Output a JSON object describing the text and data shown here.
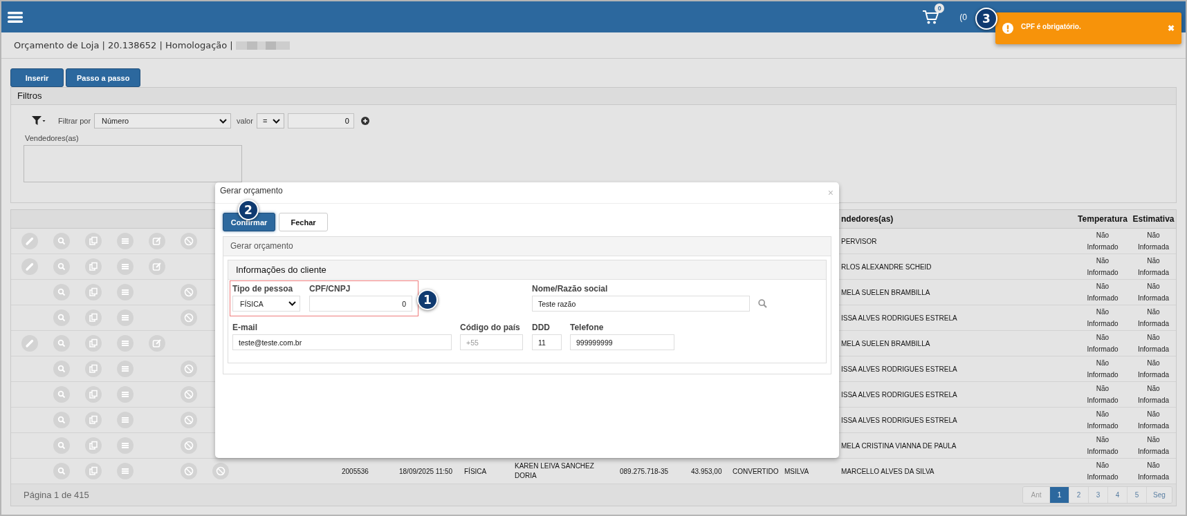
{
  "topbar": {
    "cart_count": "0",
    "user_text": "(0"
  },
  "toast": {
    "message": "CPF é obrigatório.",
    "close": "✖",
    "step": "3"
  },
  "page_title": "Orçamento de Loja | 20.138652 | Homologação |",
  "actions": [
    {
      "label": "Inserir"
    },
    {
      "label": "Passo a passo"
    }
  ],
  "filters": {
    "title": "Filtros",
    "filter_by_label": "Filtrar por",
    "filter_by": "Número",
    "value_label": "valor",
    "operator": "=",
    "value": "0",
    "sellers_label": "Vendedores(as)"
  },
  "table": {
    "columns": [
      "ndedores(as)",
      "Temperatura",
      "Estimativa"
    ],
    "rows": [
      {
        "actions": [
          {
            "kind": "pencil"
          },
          {
            "kind": "search"
          },
          {
            "kind": "copy"
          },
          {
            "kind": "list"
          },
          {
            "kind": "edit"
          },
          {
            "kind": "ban"
          }
        ],
        "seller": "PERVISOR",
        "temperature": "Não Informado",
        "estimate": "Não Informada"
      },
      {
        "actions": [
          {
            "kind": "pencil"
          },
          {
            "kind": "search"
          },
          {
            "kind": "copy"
          },
          {
            "kind": "list"
          },
          {
            "kind": "edit"
          }
        ],
        "seller": "RLOS ALEXANDRE SCHEID",
        "temperature": "Não Informado",
        "estimate": "Não Informada"
      },
      {
        "actions": [
          {
            "kind": "none"
          },
          {
            "kind": "search"
          },
          {
            "kind": "copy"
          },
          {
            "kind": "list"
          },
          {
            "kind": "none"
          },
          {
            "kind": "ban"
          }
        ],
        "seller": "MELA SUELEN BRAMBILLA",
        "temperature": "Não Informado",
        "estimate": "Não Informada"
      },
      {
        "actions": [
          {
            "kind": "none"
          },
          {
            "kind": "search"
          },
          {
            "kind": "copy"
          },
          {
            "kind": "list"
          },
          {
            "kind": "none"
          },
          {
            "kind": "ban"
          }
        ],
        "seller": "ISSA ALVES RODRIGUES ESTRELA",
        "temperature": "Não Informado",
        "estimate": "Não Informada"
      },
      {
        "actions": [
          {
            "kind": "pencil"
          },
          {
            "kind": "search"
          },
          {
            "kind": "copy"
          },
          {
            "kind": "list"
          },
          {
            "kind": "edit"
          }
        ],
        "seller": "MELA SUELEN BRAMBILLA",
        "temperature": "Não Informado",
        "estimate": "Não Informada"
      },
      {
        "actions": [
          {
            "kind": "none"
          },
          {
            "kind": "search"
          },
          {
            "kind": "copy"
          },
          {
            "kind": "list"
          },
          {
            "kind": "none"
          },
          {
            "kind": "ban"
          }
        ],
        "seller": "ISSA ALVES RODRIGUES ESTRELA",
        "temperature": "Não Informado",
        "estimate": "Não Informada"
      },
      {
        "actions": [
          {
            "kind": "none"
          },
          {
            "kind": "search"
          },
          {
            "kind": "copy"
          },
          {
            "kind": "list"
          },
          {
            "kind": "none"
          },
          {
            "kind": "ban"
          }
        ],
        "seller": "ISSA ALVES RODRIGUES ESTRELA",
        "temperature": "Não Informado",
        "estimate": "Não Informada"
      },
      {
        "actions": [
          {
            "kind": "none"
          },
          {
            "kind": "search"
          },
          {
            "kind": "copy"
          },
          {
            "kind": "list"
          },
          {
            "kind": "none"
          },
          {
            "kind": "ban"
          }
        ],
        "seller": "ISSA ALVES RODRIGUES ESTRELA",
        "temperature": "Não Informado",
        "estimate": "Não Informada"
      },
      {
        "actions": [
          {
            "kind": "none"
          },
          {
            "kind": "search"
          },
          {
            "kind": "copy"
          },
          {
            "kind": "list"
          },
          {
            "kind": "none"
          },
          {
            "kind": "ban"
          }
        ],
        "seller": "MELA CRISTINA VIANNA DE PAULA",
        "temperature": "Não Informado",
        "estimate": "Não Informada"
      },
      {
        "actions": [
          {
            "kind": "none"
          },
          {
            "kind": "search"
          },
          {
            "kind": "copy"
          },
          {
            "kind": "list"
          },
          {
            "kind": "none"
          },
          {
            "kind": "ban"
          },
          {
            "kind": "ban"
          }
        ],
        "cells": [
          "2005536",
          "18/09/2025 11:50",
          "FÍSICA",
          "KAREN LEIVA SANCHEZ DORIA",
          "089.275.718-35",
          "43.953,00",
          "CONVERTIDO",
          "MSILVA"
        ],
        "seller": "MARCELLO ALVES DA SILVA",
        "temperature": "Não Informado",
        "estimate": "Não Informada"
      }
    ]
  },
  "footer": {
    "page_info": "Página 1 de 415",
    "pages": [
      {
        "label": "Ant",
        "selected": false,
        "disabled": true
      },
      {
        "label": "1",
        "selected": true,
        "disabled": false
      },
      {
        "label": "2",
        "selected": false,
        "disabled": false
      },
      {
        "label": "3",
        "selected": false,
        "disabled": false
      },
      {
        "label": "4",
        "selected": false,
        "disabled": false
      },
      {
        "label": "5",
        "selected": false,
        "disabled": false
      },
      {
        "label": "Seg",
        "selected": false,
        "disabled": false
      }
    ]
  },
  "modal": {
    "title": "Gerar orçamento",
    "close": "×",
    "buttons": [
      {
        "label": "Confirmar",
        "kind": "primary",
        "step": "2"
      },
      {
        "label": "Fechar",
        "kind": "default"
      }
    ],
    "panel_title": "Gerar orçamento",
    "client": {
      "title": "Informações do cliente",
      "highlight": {
        "on": true,
        "step": "1"
      },
      "person_type": {
        "label": "Tipo de pessoa",
        "value": "FÍSICA"
      },
      "document": {
        "label": "CPF/CNPJ",
        "value": "0"
      },
      "name": {
        "label": "Nome/Razão social",
        "value": "Teste razão"
      },
      "email": {
        "label": "E-mail",
        "value": "teste@teste.com.br"
      },
      "country_code": {
        "label": "Código do país",
        "placeholder": "+55"
      },
      "ddd": {
        "label": "DDD",
        "value": "11"
      },
      "phone": {
        "label": "Telefone",
        "value": "999999999"
      }
    }
  }
}
